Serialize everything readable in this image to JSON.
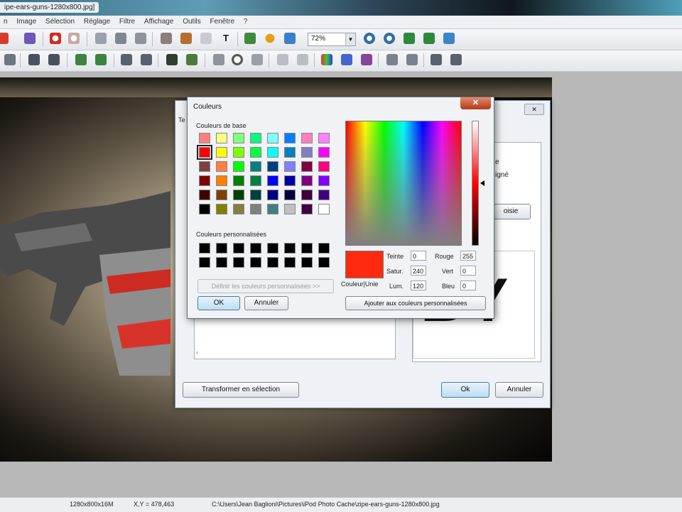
{
  "window": {
    "title": "ipe-ears-guns-1280x800.jpg]"
  },
  "menu": [
    "n",
    "Image",
    "Sélection",
    "Réglage",
    "Filtre",
    "Affichage",
    "Outils",
    "Fenêtre",
    "?"
  ],
  "toolbar": {
    "zoom_value": "72%",
    "text_tool": "T"
  },
  "canvas": {
    "big_text": "BY"
  },
  "status": {
    "size": "1280x800x16M",
    "coords": "X,Y = 478,463",
    "path": "C:\\Users\\Jean Baglioni\\Pictures\\iPod Photo Cache\\zipe-ears-guns-1280x800.jpg"
  },
  "back_dialog": {
    "title_fragment": "Te",
    "right_label_1": "e",
    "right_label_2": "igné",
    "right_button": "oisie",
    "transform_button": "Transformer en sélection",
    "ok_button": "Ok",
    "cancel_button": "Annuler"
  },
  "color_dialog": {
    "title": "Couleurs",
    "close_icon": "close-icon",
    "basic_label": "Couleurs de base",
    "custom_label": "Couleurs personnalisées",
    "define_button": "Définir les couleurs personnalisées >>",
    "ok_button": "OK",
    "cancel_button": "Annuler",
    "solid_label": "Couleur|Unie",
    "add_button": "Ajouter aux couleurs personnalisées",
    "fields": {
      "hue_label": "Teinte",
      "hue": "0",
      "sat_label": "Satur.",
      "sat": "240",
      "lum_label": "Lum.",
      "lum": "120",
      "red_label": "Rouge",
      "red": "255",
      "green_label": "Vert",
      "green": "0",
      "blue_label": "Bleu",
      "blue": "0"
    },
    "selected_color": "#ff2a10",
    "basic_colors": [
      [
        "#ff8080",
        "#ffff80",
        "#80ff80",
        "#00ff80",
        "#80ffff",
        "#0080ff",
        "#ff80c0",
        "#ff80ff"
      ],
      [
        "#ff0000",
        "#ffff00",
        "#80ff00",
        "#00ff40",
        "#00ffff",
        "#0080c0",
        "#8080c0",
        "#ff00ff"
      ],
      [
        "#804040",
        "#ff8040",
        "#00ff00",
        "#008080",
        "#004080",
        "#8080ff",
        "#800040",
        "#ff0080"
      ],
      [
        "#800000",
        "#ff8000",
        "#008000",
        "#008040",
        "#0000ff",
        "#0000a0",
        "#800080",
        "#8000ff"
      ],
      [
        "#400000",
        "#804000",
        "#004000",
        "#004040",
        "#000080",
        "#000040",
        "#400040",
        "#400080"
      ],
      [
        "#000000",
        "#808000",
        "#808040",
        "#808080",
        "#408080",
        "#c0c0c0",
        "#400040",
        "#ffffff"
      ]
    ]
  }
}
